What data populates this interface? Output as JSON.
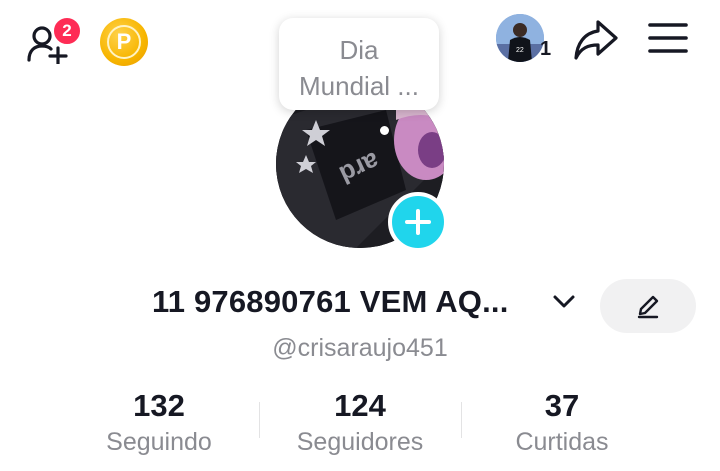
{
  "header": {
    "add_friends_badge": "2",
    "coin_letter": "P",
    "friend_count": "1"
  },
  "bubble": {
    "text_line1": "Dia",
    "text_line2": "Mundial ..."
  },
  "profile": {
    "name": "11 976890761 VEM AQ...",
    "handle": "@crisaraujo451"
  },
  "stats": [
    {
      "value": "132",
      "label": "Seguindo"
    },
    {
      "value": "124",
      "label": "Seguidores"
    },
    {
      "value": "37",
      "label": "Curtidas"
    }
  ],
  "colors": {
    "accent": "#20d5ec",
    "badge": "#fe2c55",
    "coin": "#f7b500"
  }
}
